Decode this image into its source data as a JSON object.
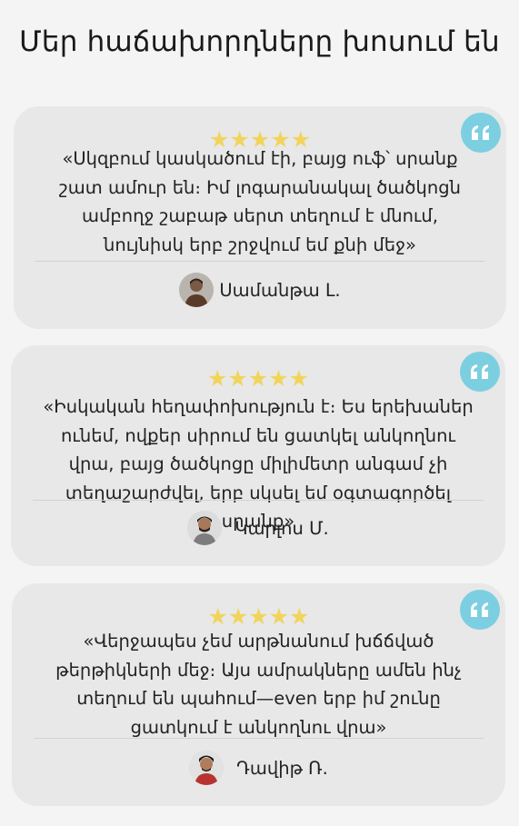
{
  "page": {
    "title": "Մեր հաճախորդները խոսում են"
  },
  "colors": {
    "background": "#f4f4f4",
    "card": "#e8e8e8",
    "star": "#f1d45c",
    "quote_badge": "#7ccfe0"
  },
  "testimonials": [
    {
      "rating": 5,
      "stars": "★★★★★",
      "text": "«Սկզբում կասկածում էի, բայց ուֆ՝ սրանք շատ ամուր են։ Իմ լոգարանակալ ծածկոցն ամբողջ շաբաթ սերտ տեղում է մնում, նույնիսկ երբ շրջվում եմ քնի մեջ»",
      "author": "Սամանթա Լ.",
      "avatar_icon": "person-avatar-icon"
    },
    {
      "rating": 5,
      "stars": "★★★★★",
      "text": "«Իսկական հեղափոխություն է։ Ես երեխաներ ունեմ, ովքեր սիրում են ցատկել անկողնու վրա, բայց ծածկոցը միլիմետր անգամ չի տեղաշարժվել, երբ սկսել եմ օգտագործել սրանք»",
      "author": "Կարլոս Մ.",
      "avatar_icon": "person-avatar-icon"
    },
    {
      "rating": 5,
      "stars": "★★★★★",
      "text": "«Վերջապես չեմ արթնանում խճճված թերթիկների մեջ։ Այս ամրակները ամեն ինչ տեղում են պահում—even երբ իմ շունը ցատկում է անկողնու վրա»",
      "author": "Դավիթ Ռ.",
      "avatar_icon": "person-avatar-icon"
    }
  ],
  "icons": {
    "quote": "quote-icon",
    "star": "star-icon"
  }
}
